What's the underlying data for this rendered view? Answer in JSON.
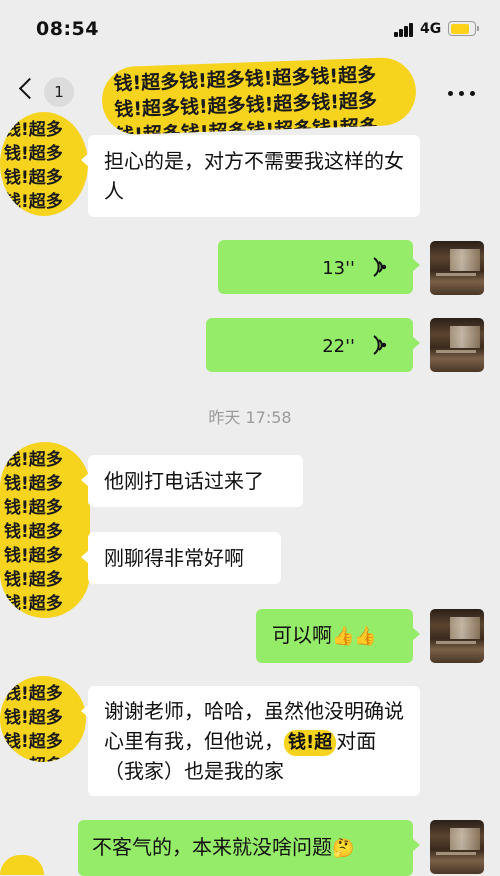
{
  "status": {
    "time": "08:54",
    "network": "4G"
  },
  "nav": {
    "unread_count": "1"
  },
  "pattern_text": "钱!超多钱!超多钱!超多钱!超多钱!超多钱!超多钱!超多钱!超多钱!超多钱!超多钱!超多钱!超多钱!超多钱!超多钱!超多钱!超多钱!超多",
  "messages": [
    {
      "side": "left",
      "type": "text",
      "text": "担心的是，对方不需要我这样的女人"
    },
    {
      "side": "right",
      "type": "voice",
      "duration": "13''"
    },
    {
      "side": "right",
      "type": "voice",
      "duration": "22''"
    },
    {
      "type": "time",
      "text": "昨天 17:58"
    },
    {
      "side": "left",
      "type": "text",
      "text": "他刚打电话过来了"
    },
    {
      "side": "left",
      "type": "text",
      "text": "刚聊得非常好啊"
    },
    {
      "side": "right",
      "type": "text",
      "text": "可以啊",
      "emojis": "👍👍"
    },
    {
      "side": "left",
      "type": "text",
      "text_before": "谢谢老师，哈哈，虽然他没明确说心里有我，但他说，",
      "text_pattern": "钱!超",
      "text_after": "对面（我家）也是我的家"
    },
    {
      "side": "right",
      "type": "text",
      "text": "不客气的，本来就没啥问题",
      "emojis": "🤔"
    }
  ]
}
